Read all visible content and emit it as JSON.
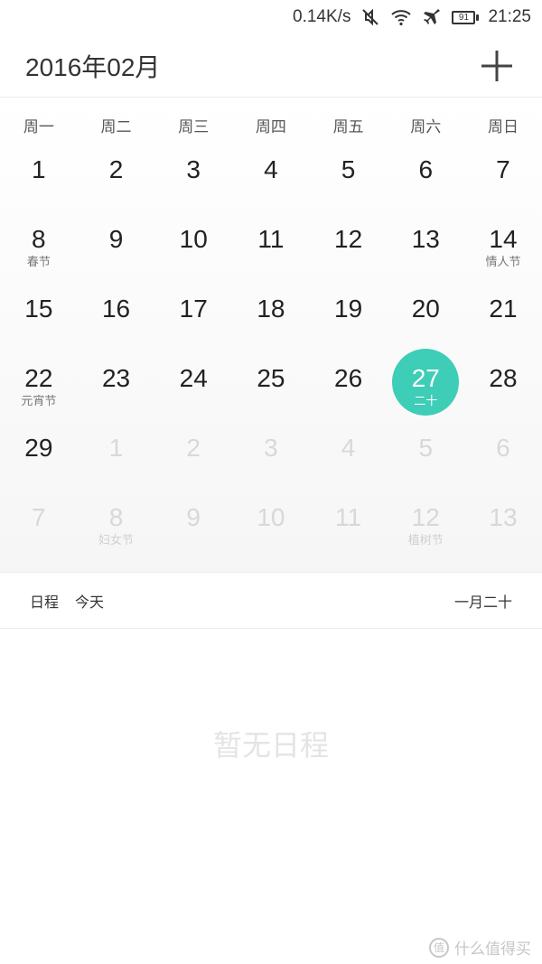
{
  "status_bar": {
    "net_speed": "0.14K/s",
    "battery": "91",
    "time": "21:25",
    "icons": [
      "mute-icon",
      "wifi-icon",
      "airplane-icon",
      "battery-icon"
    ]
  },
  "header": {
    "title": "2016年02月",
    "add_icon": "plus-icon"
  },
  "calendar": {
    "weekdays": [
      "周一",
      "周二",
      "周三",
      "周四",
      "周五",
      "周六",
      "周日"
    ],
    "accent": "#3ecdb7",
    "days": [
      {
        "n": "1",
        "sub": "",
        "other": false,
        "today": false
      },
      {
        "n": "2",
        "sub": "",
        "other": false,
        "today": false
      },
      {
        "n": "3",
        "sub": "",
        "other": false,
        "today": false
      },
      {
        "n": "4",
        "sub": "",
        "other": false,
        "today": false
      },
      {
        "n": "5",
        "sub": "",
        "other": false,
        "today": false
      },
      {
        "n": "6",
        "sub": "",
        "other": false,
        "today": false
      },
      {
        "n": "7",
        "sub": "",
        "other": false,
        "today": false
      },
      {
        "n": "8",
        "sub": "春节",
        "other": false,
        "today": false
      },
      {
        "n": "9",
        "sub": "",
        "other": false,
        "today": false
      },
      {
        "n": "10",
        "sub": "",
        "other": false,
        "today": false
      },
      {
        "n": "11",
        "sub": "",
        "other": false,
        "today": false
      },
      {
        "n": "12",
        "sub": "",
        "other": false,
        "today": false
      },
      {
        "n": "13",
        "sub": "",
        "other": false,
        "today": false
      },
      {
        "n": "14",
        "sub": "情人节",
        "other": false,
        "today": false
      },
      {
        "n": "15",
        "sub": "",
        "other": false,
        "today": false
      },
      {
        "n": "16",
        "sub": "",
        "other": false,
        "today": false
      },
      {
        "n": "17",
        "sub": "",
        "other": false,
        "today": false
      },
      {
        "n": "18",
        "sub": "",
        "other": false,
        "today": false
      },
      {
        "n": "19",
        "sub": "",
        "other": false,
        "today": false
      },
      {
        "n": "20",
        "sub": "",
        "other": false,
        "today": false
      },
      {
        "n": "21",
        "sub": "",
        "other": false,
        "today": false
      },
      {
        "n": "22",
        "sub": "元宵节",
        "other": false,
        "today": false
      },
      {
        "n": "23",
        "sub": "",
        "other": false,
        "today": false
      },
      {
        "n": "24",
        "sub": "",
        "other": false,
        "today": false
      },
      {
        "n": "25",
        "sub": "",
        "other": false,
        "today": false
      },
      {
        "n": "26",
        "sub": "",
        "other": false,
        "today": false
      },
      {
        "n": "27",
        "sub": "二十",
        "other": false,
        "today": true
      },
      {
        "n": "28",
        "sub": "",
        "other": false,
        "today": false
      },
      {
        "n": "29",
        "sub": "",
        "other": false,
        "today": false
      },
      {
        "n": "1",
        "sub": "",
        "other": true,
        "today": false
      },
      {
        "n": "2",
        "sub": "",
        "other": true,
        "today": false
      },
      {
        "n": "3",
        "sub": "",
        "other": true,
        "today": false
      },
      {
        "n": "4",
        "sub": "",
        "other": true,
        "today": false
      },
      {
        "n": "5",
        "sub": "",
        "other": true,
        "today": false
      },
      {
        "n": "6",
        "sub": "",
        "other": true,
        "today": false
      },
      {
        "n": "7",
        "sub": "",
        "other": true,
        "today": false
      },
      {
        "n": "8",
        "sub": "妇女节",
        "other": true,
        "today": false
      },
      {
        "n": "9",
        "sub": "",
        "other": true,
        "today": false
      },
      {
        "n": "10",
        "sub": "",
        "other": true,
        "today": false
      },
      {
        "n": "11",
        "sub": "",
        "other": true,
        "today": false
      },
      {
        "n": "12",
        "sub": "植树节",
        "other": true,
        "today": false
      },
      {
        "n": "13",
        "sub": "",
        "other": true,
        "today": false
      }
    ]
  },
  "schedule": {
    "label": "日程",
    "today": "今天",
    "lunar_date": "一月二十",
    "empty_text": "暂无日程"
  },
  "watermark": {
    "text": "什么值得买",
    "logo": "值"
  }
}
